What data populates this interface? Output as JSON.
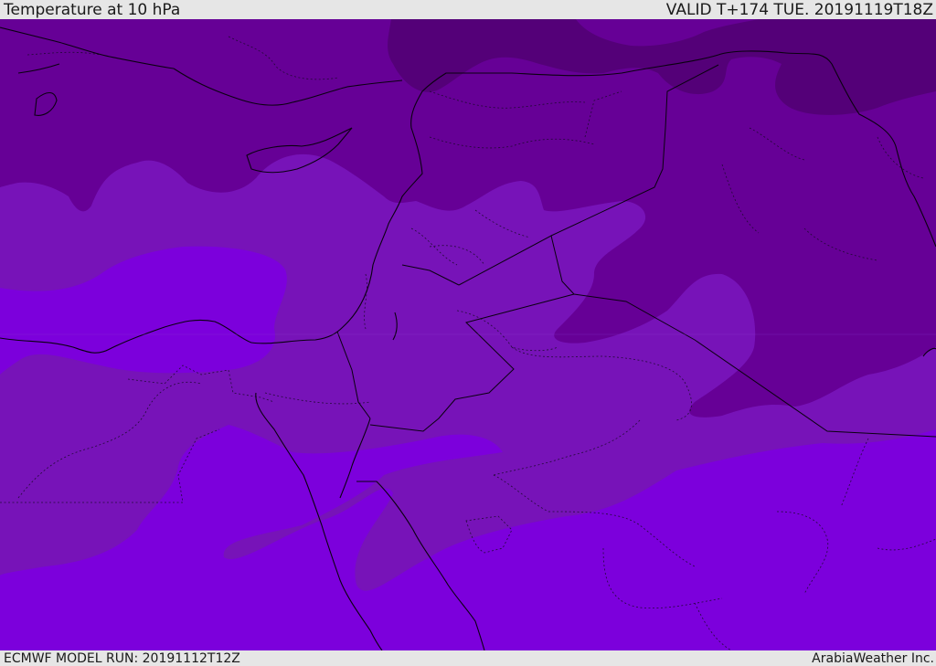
{
  "header": {
    "title": "Temperature at 10 hPa",
    "valid": "VALID T+174 TUE. 20191119T18Z"
  },
  "footer": {
    "model_run": "ECMWF MODEL RUN: 20191112T12Z",
    "credit": "ArabiaWeather Inc."
  },
  "map": {
    "field": "temperature",
    "level": "10 hPa",
    "colors": {
      "coldest": "#540078",
      "colder": "#660096",
      "mid": "#7713b8",
      "warm": "#7c00dc"
    },
    "features": [
      "coastlines",
      "country-borders",
      "province-borders"
    ]
  }
}
